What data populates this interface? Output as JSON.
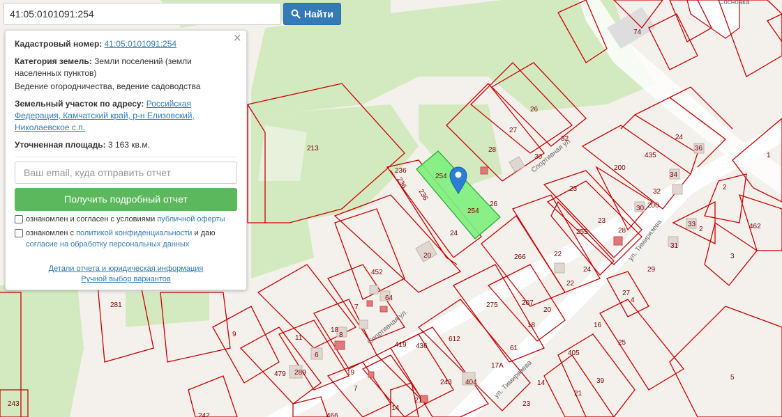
{
  "search": {
    "value": "41:05:0101091:254",
    "button_label": "Найти"
  },
  "panel": {
    "cadastral_label": "Кадастровый номер:",
    "cadastral_value": "41:05:0101091:254",
    "category_label": "Категория земель:",
    "category_value": "Земли поселений (земли населенных пунктов)",
    "usage": "Ведение огородничества, ведение садоводства",
    "address_label": "Земельный участок по адресу:",
    "address_value": "Российская Федерация, Камчатский край, р-н Елизовский, Николаевское с.п.",
    "area_label": "Уточненная площадь:",
    "area_value": "3 163 кв.м.",
    "email_placeholder": "Ваш email, куда отправить отчет",
    "report_button": "Получить подробный отчет",
    "check1_text": "ознакомлен и согласен с условиями",
    "check1_link": "публичной оферты",
    "check2_text": "ознакомлен с",
    "check2_link": "политикой конфиденциальности",
    "check2_mid": "и даю",
    "check2_link2": "согласие на обработку персональных данных",
    "details_link": "Детали отчета и юридическая информация",
    "manual_link": "Ручной выбор вариантов"
  },
  "map": {
    "place_name": "Сосновка",
    "streets": [
      "Спортивная ул.",
      "ул. Тимирязева"
    ],
    "parcel_labels": [
      "74",
      "26",
      "27",
      "28",
      "30",
      "32",
      "213",
      "254",
      "236",
      "24",
      "20",
      "26",
      "200",
      "435",
      "24",
      "36",
      "34",
      "32",
      "30",
      "200",
      "1",
      "2",
      "462",
      "3",
      "2",
      "33",
      "31",
      "23",
      "23",
      "255",
      "28",
      "22",
      "266",
      "24",
      "22",
      "29",
      "27",
      "4",
      "207",
      "275",
      "20",
      "18",
      "61",
      "16",
      "25",
      "612",
      "419",
      "436",
      "243",
      "404",
      "17А",
      "14",
      "21",
      "39",
      "5",
      "452",
      "7",
      "64",
      "18",
      "8",
      "11",
      "9",
      "281",
      "479",
      "289",
      "7",
      "14",
      "21",
      "243",
      "242",
      "466",
      "405",
      "23",
      "19",
      "6",
      "9"
    ],
    "colors": {
      "parcel_stroke": "#cc0000",
      "selected_fill": "#7cf07c",
      "green_area": "#cfe8b9",
      "background": "#f4f1ec",
      "marker": "#2a7fd4"
    }
  }
}
